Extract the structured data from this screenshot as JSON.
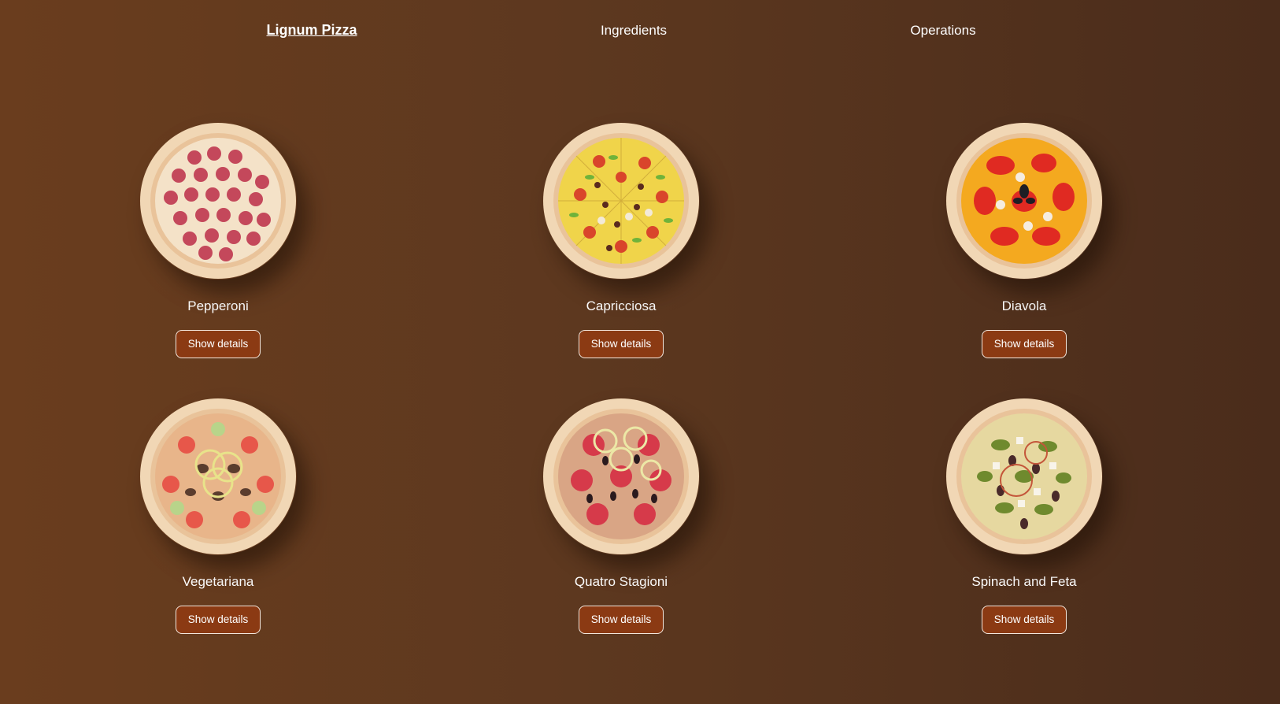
{
  "nav": {
    "brand": "Lignum Pizza",
    "ingredients": "Ingredients",
    "operations": "Operations"
  },
  "pizzas": [
    {
      "name": "Pepperoni",
      "button_label": "Show details"
    },
    {
      "name": "Capricciosa",
      "button_label": "Show details"
    },
    {
      "name": "Diavola",
      "button_label": "Show details"
    },
    {
      "name": "Vegetariana",
      "button_label": "Show details"
    },
    {
      "name": "Quatro Stagioni",
      "button_label": "Show details"
    },
    {
      "name": "Spinach and Feta",
      "button_label": "Show details"
    }
  ],
  "colors": {
    "background_start": "#6a3d1e",
    "background_end": "#4a2c1b",
    "button_fill": "#8b3a13",
    "button_border": "#f3e6dc",
    "text": "#ffffff"
  }
}
